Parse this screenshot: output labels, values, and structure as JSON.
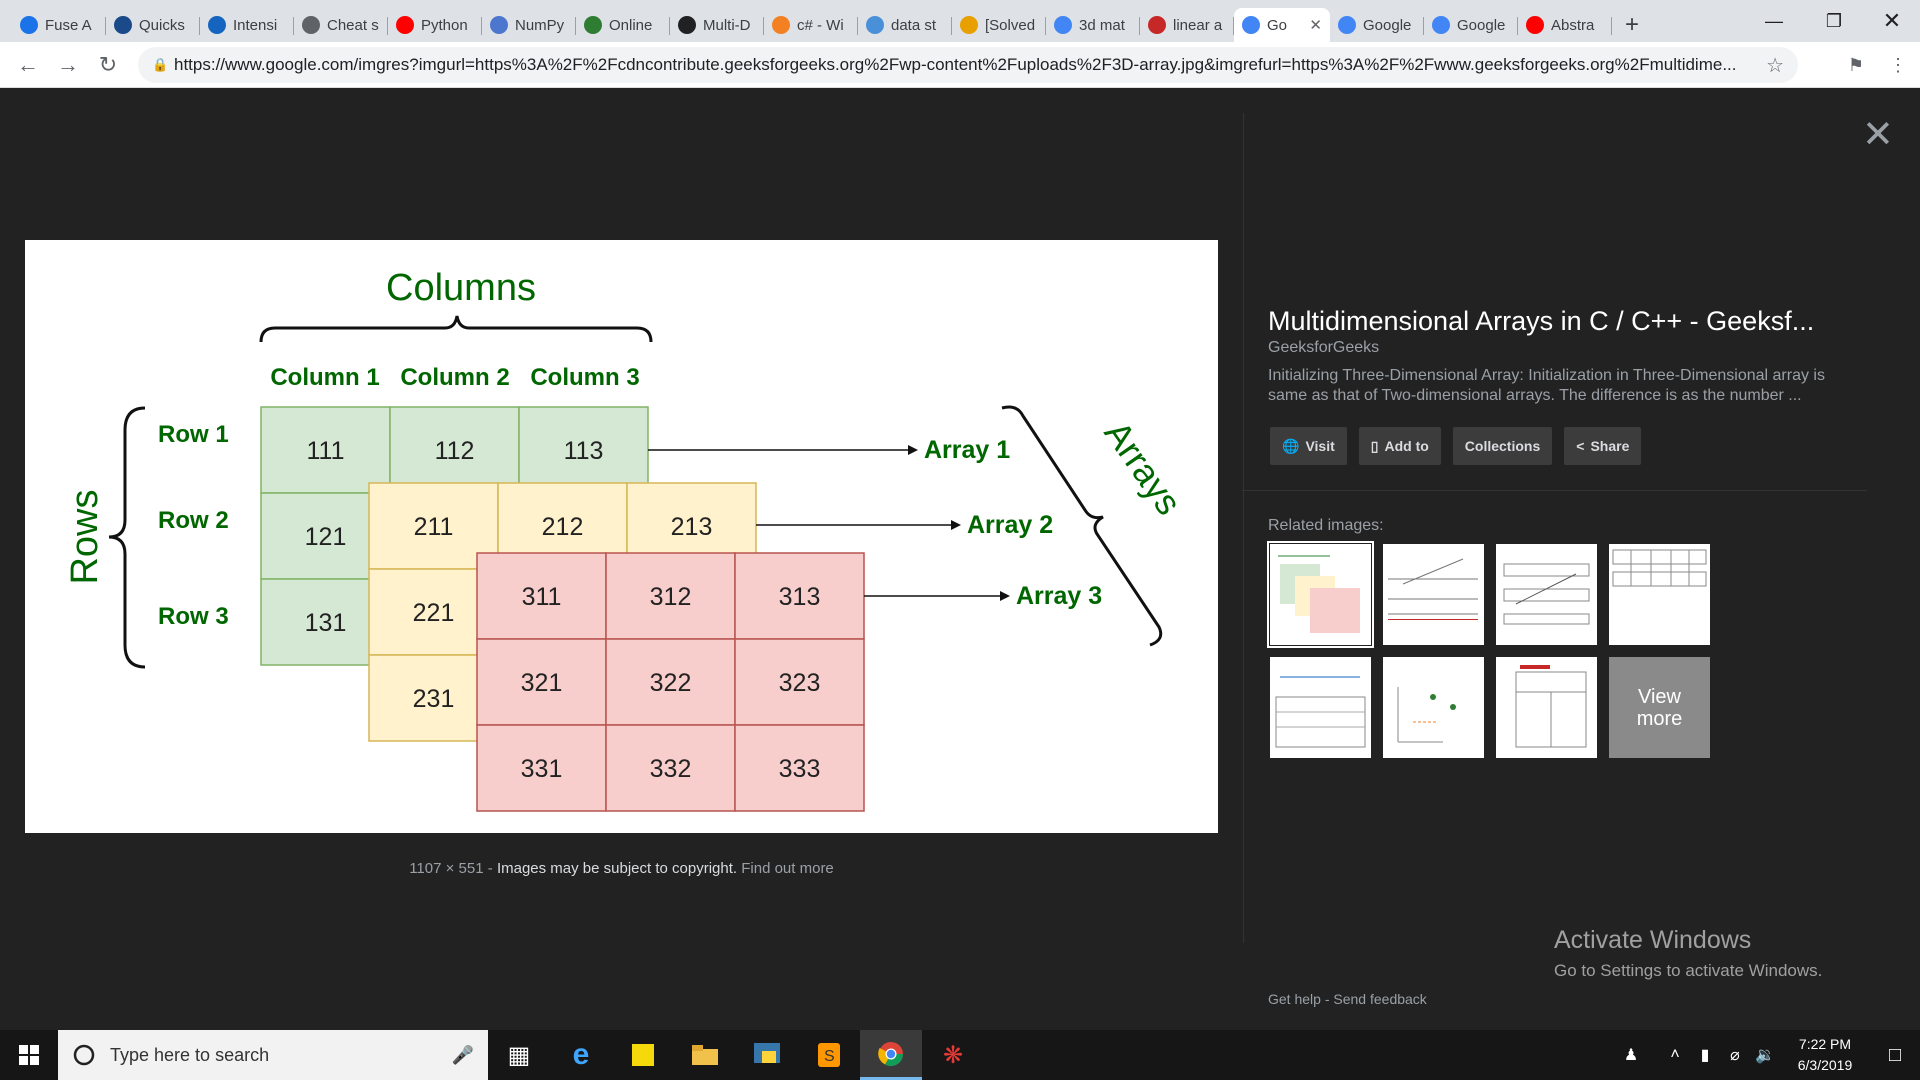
{
  "browser": {
    "tabs": [
      {
        "title": "Fuse A",
        "icon": "fuse-icon",
        "color": "#1a73e8"
      },
      {
        "title": "Quicks",
        "icon": "quicksort-icon",
        "color": "#1a4a8a"
      },
      {
        "title": "Intensi",
        "icon": "k-icon",
        "color": "#1565c0"
      },
      {
        "title": "Cheat s",
        "icon": "globe-icon",
        "color": "#5f6368"
      },
      {
        "title": "Python",
        "icon": "youtube-icon",
        "color": "#ff0000"
      },
      {
        "title": "NumPy",
        "icon": "numpy-icon",
        "color": "#4d77cf"
      },
      {
        "title": "Online",
        "icon": "code-icon",
        "color": "#2e7d32"
      },
      {
        "title": "Multi-D",
        "icon": "o-icon",
        "color": "#202124"
      },
      {
        "title": "c# - Wi",
        "icon": "stackoverflow-icon",
        "color": "#f48024"
      },
      {
        "title": "data st",
        "icon": "graph-icon",
        "color": "#4a90d9"
      },
      {
        "title": "[Solved",
        "icon": "solved-icon",
        "color": "#e8a000"
      },
      {
        "title": "3d mat",
        "icon": "google-icon",
        "color": "#4285f4"
      },
      {
        "title": "linear a",
        "icon": "gear-red-icon",
        "color": "#c62828"
      },
      {
        "title": "Go",
        "icon": "google-icon",
        "color": "#4285f4",
        "active": true
      },
      {
        "title": "Google",
        "icon": "google-icon",
        "color": "#4285f4"
      },
      {
        "title": "Google",
        "icon": "google-icon",
        "color": "#4285f4"
      },
      {
        "title": "Abstra",
        "icon": "youtube-icon",
        "color": "#ff0000"
      }
    ],
    "url": "https://www.google.com/imgres?imgurl=https%3A%2F%2Fcdncontribute.geeksforgeeks.org%2Fwp-content%2Fuploads%2F3D-array.jpg&imgrefurl=https%3A%2F%2Fwww.geeksforgeeks.org%2Fmultidime..."
  },
  "diagram": {
    "columns_title": "Columns",
    "column_labels": [
      "Column 1",
      "Column 2",
      "Column 3"
    ],
    "rows_title": "Rows",
    "row_labels": [
      "Row 1",
      "Row 2",
      "Row 3"
    ],
    "arrays_title": "Arrays",
    "array_labels": [
      "Array 1",
      "Array 2",
      "Array 3"
    ],
    "layer1": [
      "111",
      "112",
      "113",
      "121",
      "131"
    ],
    "layer2": [
      "211",
      "212",
      "213",
      "221",
      "231"
    ],
    "layer3": [
      "311",
      "312",
      "313",
      "321",
      "322",
      "323",
      "331",
      "332",
      "333"
    ],
    "colors": {
      "green_fill": "#d5e8d4",
      "green_stroke": "#82b366",
      "yellow_fill": "#fff2cc",
      "yellow_stroke": "#d6b656",
      "red_fill": "#f8cecc",
      "red_stroke": "#b85450",
      "label_green": "#006600"
    }
  },
  "caption": {
    "dims": "1107 × 551",
    "sep": " - ",
    "copyright": "Images may be subject to copyright.",
    "find_out": "Find out more"
  },
  "panel": {
    "title": "Multidimensional Arrays in C / C++ - Geeksf...",
    "source": "GeeksforGeeks",
    "description": "Initializing Three-Dimensional Array: Initialization in Three-Dimensional array is same as that of Two-dimensional arrays. The difference is as the number ...",
    "buttons": {
      "visit": "Visit",
      "add_to": "Add to",
      "collections": "Collections",
      "share": "Share"
    },
    "related_label": "Related images:",
    "view_more": "View more",
    "help": "Get help",
    "feedback": "Send feedback",
    "help_sep": " - "
  },
  "watermark": {
    "line1": "Activate Windows",
    "line2": "Go to Settings to activate Windows."
  },
  "taskbar": {
    "search_placeholder": "Type here to search",
    "time": "7:22 PM",
    "date": "6/3/2019"
  }
}
